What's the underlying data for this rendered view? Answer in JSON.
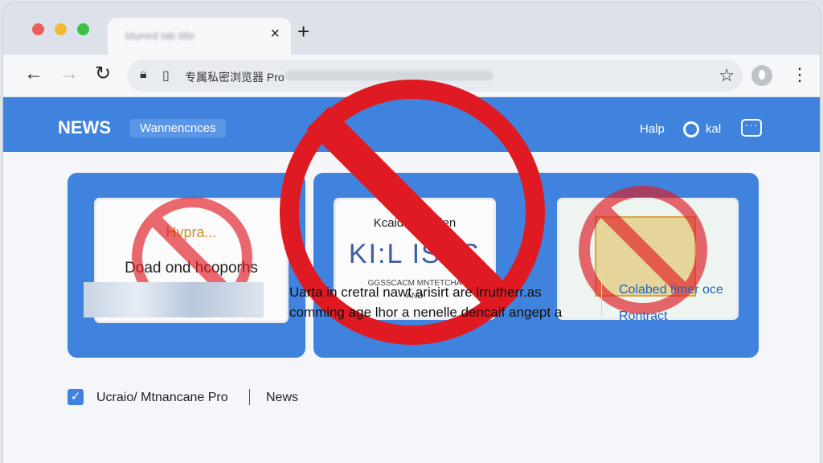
{
  "browser": {
    "tab_title": "blurred tab title",
    "tab_close": "×",
    "new_tab": "+",
    "nav": {
      "back": "←",
      "forward": "→",
      "reload": "↻"
    },
    "url_text": "专属私密浏览器 Pro",
    "star": "☆",
    "menu": "⋮"
  },
  "header": {
    "logo": "NEWS",
    "chip": "Wannencnces",
    "help": "Halp",
    "user": "kal",
    "chat_icon": "···"
  },
  "cards": [
    {
      "main": "Doad ond hcoporhs",
      "overlay": "Hvpra..."
    },
    {
      "title": "Kcaid lahoatien",
      "big": "KI:L ISES",
      "sub": "GGSSCACM MNTETCHA",
      "sub2": "AND"
    },
    {
      "main": ""
    }
  ],
  "bottom": {
    "site_name": "Ucraio/ Mtnancane Pro",
    "section": "News",
    "article_line1": "Uarta in cretral nawt arisirt are lrrutherr.as",
    "article_line2": "comming age lhor a nenelle dencaif angept a",
    "side_link1": "Colabed timer oce",
    "side_link2": "Rontract"
  },
  "colors": {
    "accent": "#3f83de",
    "ban": "#e01a22"
  }
}
